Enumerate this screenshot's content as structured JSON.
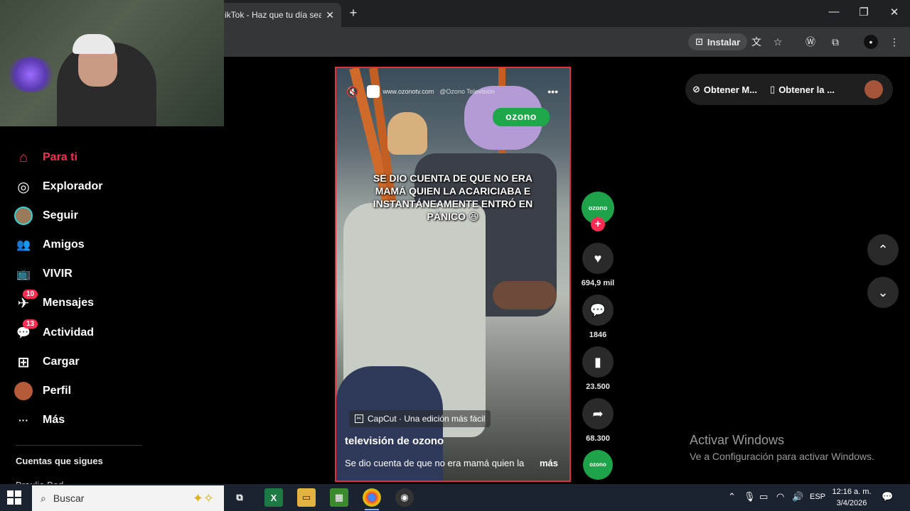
{
  "browser": {
    "tab_title": "ikTok - Haz que tu día sea",
    "tab_close": "✕",
    "new_tab": "+",
    "install_label": "Instalar",
    "window_controls": [
      "—",
      "❐",
      "✕"
    ]
  },
  "sidebar": {
    "items": [
      {
        "label": "Para ti",
        "icon": "home-icon",
        "glyph": "⌂"
      },
      {
        "label": "Explorador",
        "icon": "compass-icon",
        "glyph": "◎"
      },
      {
        "label": "Seguir",
        "icon": "avatar"
      },
      {
        "label": "Amigos",
        "icon": "friends-icon",
        "glyph": "👥"
      },
      {
        "label": "VIVIR",
        "icon": "live-icon",
        "glyph": "📺"
      },
      {
        "label": "Mensajes",
        "icon": "messages-icon",
        "glyph": "✈",
        "badge": "10"
      },
      {
        "label": "Actividad",
        "icon": "activity-icon",
        "glyph": "💬",
        "badge": "13"
      },
      {
        "label": "Cargar",
        "icon": "upload-icon",
        "glyph": "⊞"
      },
      {
        "label": "Perfil",
        "icon": "avatar"
      },
      {
        "label": "Más",
        "icon": "more-icon",
        "glyph": "···"
      }
    ],
    "following_title": "Cuentas que sigues",
    "following_partial": "Braulio Bod"
  },
  "video": {
    "top_url": "www.ozonotv.com",
    "top_handle": "@Ozono Televisión",
    "brand_logo": "ozono",
    "overlay_caption": "SE DIO CUENTA DE QUE NO ERA MAMÁ QUIEN LA ACARICIABA E INSTANTÁNEAMENTE ENTRÓ EN PÁNICO 😆",
    "capcut_label": "CapCut · Una edición más fácil",
    "author": "televisión de ozono",
    "description": "Se dio cuenta de que no era mamá quien la",
    "more_label": "más"
  },
  "rail": {
    "avatar_text": "ozono",
    "likes": "694,9 mil",
    "comments": "1846",
    "saves": "23.500",
    "shares": "68.300",
    "music_text": "ozono"
  },
  "top_right": {
    "pill1": "Obtener M...",
    "pill2": "Obtener la ..."
  },
  "activate_windows": {
    "title": "Activar Windows",
    "subtitle": "Ve a Configuración para activar Windows."
  },
  "taskbar": {
    "search_placeholder": "Buscar",
    "language": "ESP",
    "time": "12:16 a. m.",
    "date": "3/4/2026"
  },
  "colors": {
    "accent": "#fe2c55",
    "video_border": "#e0303a",
    "brand_green": "#1ea34a"
  }
}
